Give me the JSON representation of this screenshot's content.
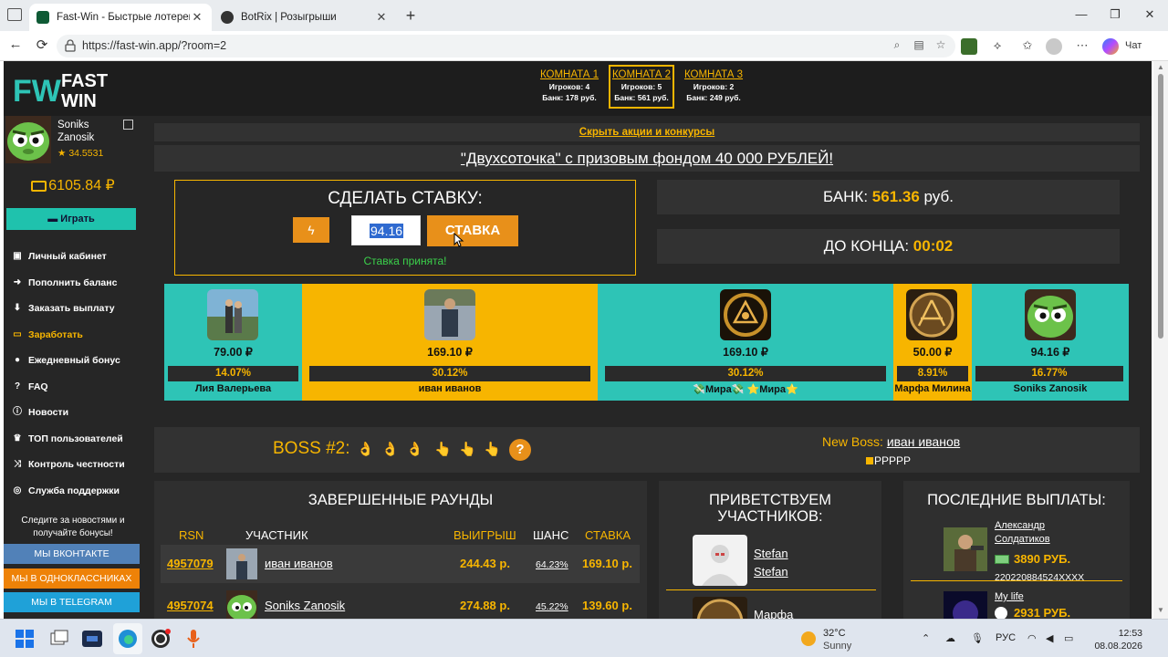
{
  "browser": {
    "tabs": [
      {
        "title": "Fast-Win - Быстрые лотереи! Ком",
        "active": true
      },
      {
        "title": "BotRix | Розыгрыши",
        "active": false
      }
    ],
    "url": "https://fast-win.app/?room=2",
    "chat_label": "Чат"
  },
  "logo": {
    "line1": "FAST",
    "line2": "WIN",
    "mark": "FW"
  },
  "rooms": [
    {
      "name": "КОМНАТА 1",
      "players": "Игроков: 4",
      "bank": "Банк: 178 руб.",
      "active": false
    },
    {
      "name": "КОМНАТА 2",
      "players": "Игроков: 5",
      "bank": "Банк: 561 руб.",
      "active": true
    },
    {
      "name": "КОМНАТА 3",
      "players": "Игроков: 2",
      "bank": "Банк: 249 руб.",
      "active": false
    }
  ],
  "user": {
    "first": "Soniks",
    "last": "Zanosik",
    "rating": "★ 34.5531",
    "balance": "6105.84 ₽"
  },
  "sidebar": {
    "play": "Играть",
    "menu": [
      {
        "label": "Личный кабинет",
        "icon": "briefcase-icon",
        "highlight": false
      },
      {
        "label": "Пополнить баланс",
        "icon": "arrow-right-circle-icon",
        "highlight": false
      },
      {
        "label": "Заказать выплату",
        "icon": "arrow-down-circle-icon",
        "highlight": false
      },
      {
        "label": "Заработать",
        "icon": "money-icon",
        "highlight": true
      },
      {
        "label": "Ежедневный бонус",
        "icon": "gift-icon",
        "highlight": false
      },
      {
        "label": "FAQ",
        "icon": "question-icon",
        "highlight": false
      },
      {
        "label": "Новости",
        "icon": "info-icon",
        "highlight": false
      },
      {
        "label": "ТОП пользователей",
        "icon": "trophy-icon",
        "highlight": false
      },
      {
        "label": "Контроль честности",
        "icon": "shuffle-icon",
        "highlight": false
      },
      {
        "label": "Служба поддержки",
        "icon": "lifebuoy-icon",
        "highlight": false
      }
    ],
    "follow_text": "Следите за новостями и получайте бонусы!",
    "social": [
      {
        "label": "МЫ ВКОНТАКТЕ",
        "color": "#5181b8"
      },
      {
        "label": "МЫ В ОДНОКЛАССНИКАХ",
        "color": "#ee8208"
      },
      {
        "label": "МЫ В TELEGRAM",
        "color": "#1fa1d8"
      }
    ]
  },
  "promo": {
    "toggle": "Скрыть акции и конкурсы",
    "headline": "\"Двухсоточка\" с призовым фондом 40 000 РУБЛЕЙ!"
  },
  "bet": {
    "title": "СДЕЛАТЬ СТАВКУ:",
    "value": "94.16",
    "button": "СТАВКА",
    "status": "Ставка принята!"
  },
  "bank": {
    "label": "БАНК:",
    "value": "561.36",
    "unit": "руб."
  },
  "timer": {
    "label": "ДО КОНЦА:",
    "value": "00:02"
  },
  "players": [
    {
      "amount": "79.00 ₽",
      "chance": "14.07%",
      "name": "Лия Валерьева",
      "color": "#2ec4b6"
    },
    {
      "amount": "169.10 ₽",
      "chance": "30.12%",
      "name": "иван иванов",
      "color": "#f7b500"
    },
    {
      "amount": "169.10 ₽",
      "chance": "30.12%",
      "name": "💸Мира💸 ⭐Мира⭐",
      "color": "#2ec4b6"
    },
    {
      "amount": "50.00 ₽",
      "chance": "8.91%",
      "name": "Марфа Милина",
      "color": "#f7b500"
    },
    {
      "amount": "94.16 ₽",
      "chance": "16.77%",
      "name": "Soniks Zanosik",
      "color": "#2ec4b6"
    }
  ],
  "boss": {
    "label": "BOSS #2:",
    "hands": [
      "👌",
      "👌",
      "👌",
      "👆",
      "👆",
      "👆"
    ],
    "help": "?",
    "new_boss_label": "New Boss:",
    "new_boss_name": "иван иванов",
    "flag_text": "PPPPP"
  },
  "rounds": {
    "title": "ЗАВЕРШЕННЫЕ РАУНДЫ",
    "headers": [
      "RSN",
      "УЧАСТНИК",
      "ВЫИГРЫШ",
      "ШАНС",
      "СТАВКА"
    ],
    "rows": [
      {
        "id": "4957079",
        "name": "иван иванов",
        "win": "244.43 р.",
        "chance": "64.23%",
        "stake": "169.10 р."
      },
      {
        "id": "4957074",
        "name": "Soniks Zanosik",
        "win": "274.88 р.",
        "chance": "45.22%",
        "stake": "139.60 р."
      }
    ]
  },
  "welcome": {
    "title": "ПРИВЕТСТВУЕМ УЧАСТНИКОВ:",
    "users": [
      {
        "line1": "Stefan",
        "line2": "Stefan"
      },
      {
        "line1": "Марфа",
        "line2": ""
      }
    ]
  },
  "payouts": {
    "title": "ПОСЛЕДНИЕ ВЫПЛАТЫ:",
    "items": [
      {
        "name_line1": "Александр",
        "name_line2": "Солдатиков",
        "amount": "3890 РУБ.",
        "wallet": "220220884524XXXX"
      },
      {
        "name_line1": "My life",
        "name_line2": "",
        "amount": "2931 РУБ.",
        "wallet": ""
      }
    ]
  },
  "taskbar": {
    "temp": "32°C",
    "condition": "Sunny",
    "lang": "РУС",
    "time": "12:53",
    "date": "08.08.2026"
  }
}
